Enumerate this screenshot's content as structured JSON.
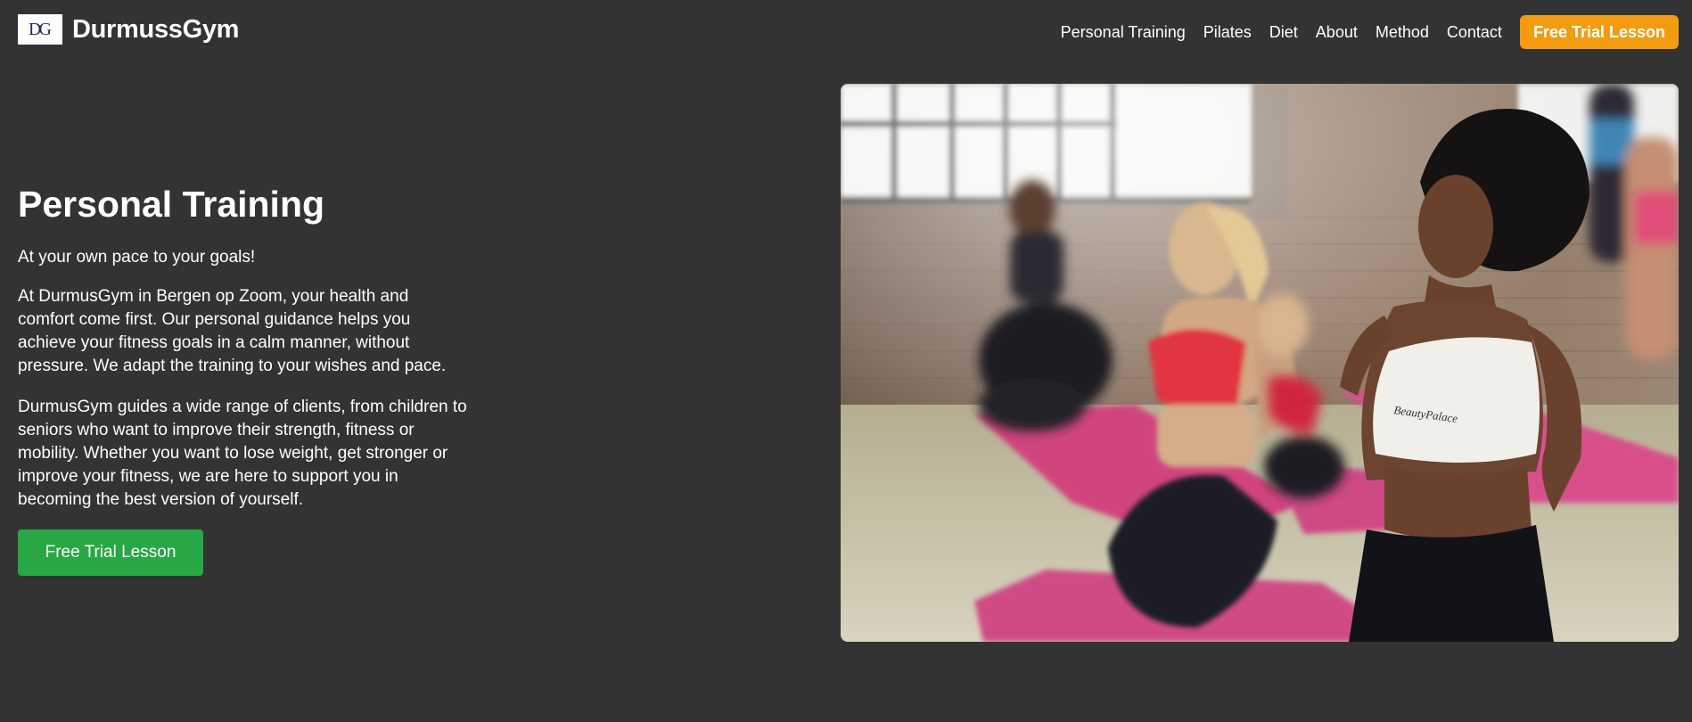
{
  "header": {
    "logo_mark": "DG",
    "brand": "DurmussGym",
    "nav": [
      {
        "label": "Personal Training"
      },
      {
        "label": "Pilates"
      },
      {
        "label": "Diet"
      },
      {
        "label": "About"
      },
      {
        "label": "Method"
      },
      {
        "label": "Contact"
      }
    ],
    "cta_label": "Free Trial Lesson"
  },
  "hero": {
    "title": "Personal Training",
    "subtitle": "At your own pace to your goals!",
    "paragraphs": [
      "At DurmusGym in Bergen op Zoom, your health and comfort come first. Our personal guidance helps you achieve your fitness goals in a calm manner, without pressure. We adapt the training to your wishes and pace.",
      "DurmusGym guides a wide range of clients, from children to seniors who want to improve their strength, fitness or mobility. Whether you want to lose weight, get stronger or improve your fitness, we are here to support you in becoming the best version of yourself."
    ],
    "cta_label": "Free Trial Lesson",
    "image": {
      "subject": "women-kneeling-on-pink-yoga-mats-in-gym",
      "print_text": "BeautyPalace"
    }
  },
  "colors": {
    "background": "#333333",
    "accent_orange": "#f39c12",
    "accent_green": "#28a745",
    "logo_ink": "#1f2a6b"
  }
}
